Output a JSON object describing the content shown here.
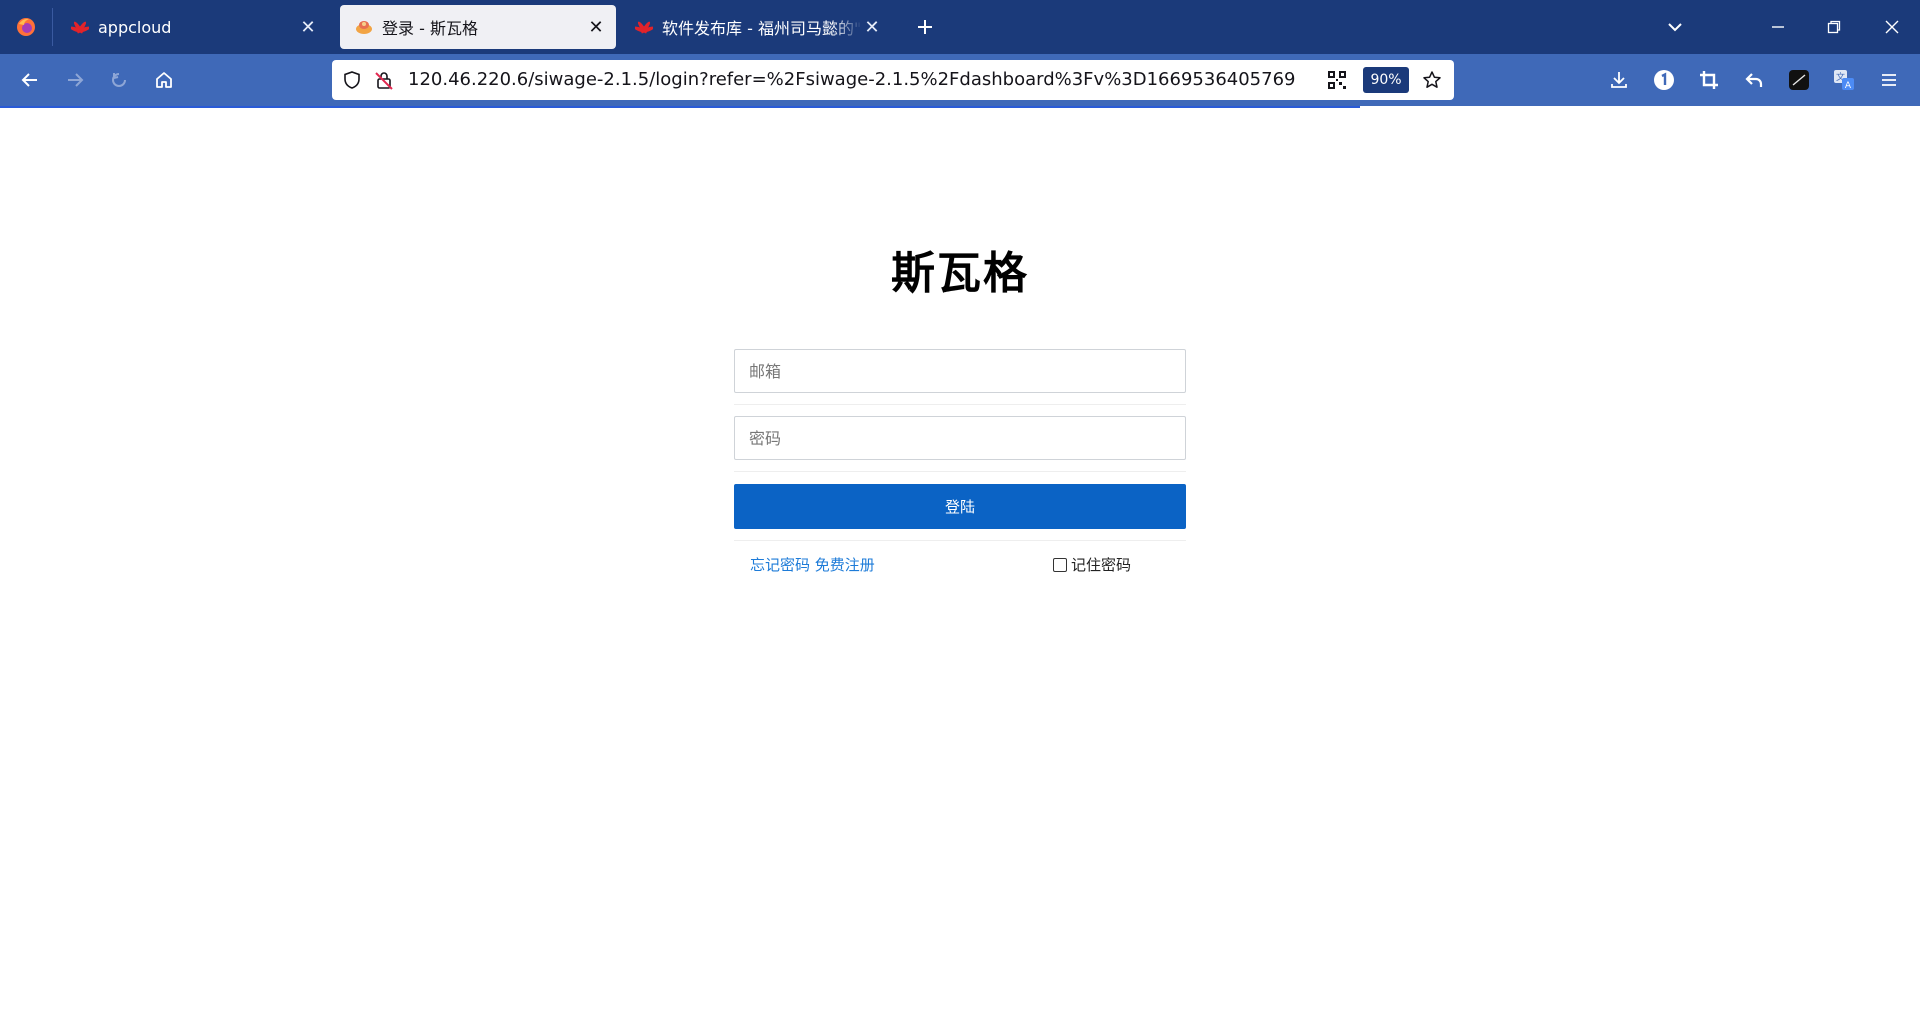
{
  "browser": {
    "tabs": [
      {
        "title": "appcloud",
        "favicon": "huawei-icon",
        "active": false
      },
      {
        "title": "登录 - 斯瓦格",
        "favicon": "swagger-icon",
        "active": true
      },
      {
        "title": "软件发布库 - 福州司马懿的\"斯瓦",
        "favicon": "huawei-icon",
        "active": false
      }
    ],
    "url": "120.46.220.6/siwage-2.1.5/login?refer=%2Fsiwage-2.1.5%2Fdashboard%3Fv%3D1669536405769",
    "zoom": "90%",
    "colors": {
      "tabstrip": "#1b3a7a",
      "navbar": "#3f69b8",
      "accent": "#0b63c5"
    }
  },
  "page": {
    "logo": "斯瓦格",
    "email_placeholder": "邮箱",
    "password_placeholder": "密码",
    "login_label": "登陆",
    "forgot_label": "忘记密码",
    "register_label": "免费注册",
    "remember_label": "记住密码"
  }
}
